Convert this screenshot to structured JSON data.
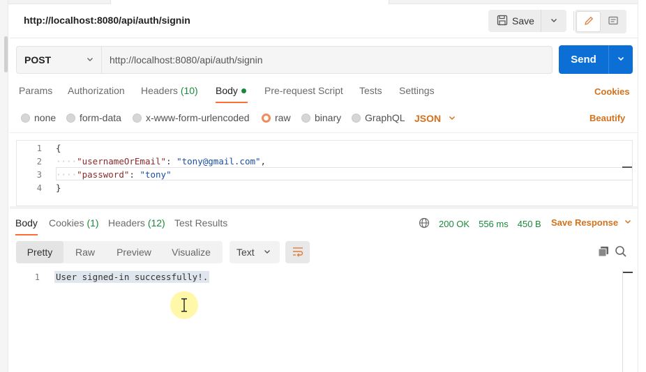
{
  "request_title": "http://localhost:8080/api/auth/signin",
  "toolbar": {
    "save_label": "Save",
    "save_icon": "floppy-disk-icon",
    "mode_icons": [
      "pencil-icon",
      "comment-icon"
    ]
  },
  "request": {
    "method": "POST",
    "url": "http://localhost:8080/api/auth/signin",
    "send_label": "Send"
  },
  "request_tabs": {
    "params": "Params",
    "authorization": "Authorization",
    "headers": "Headers",
    "headers_count": "(10)",
    "body": "Body",
    "prerequest": "Pre-request Script",
    "tests": "Tests",
    "settings": "Settings",
    "active": "Body",
    "cookies_link": "Cookies"
  },
  "body_types": {
    "none": "none",
    "form_data": "form-data",
    "urlencoded": "x-www-form-urlencoded",
    "raw": "raw",
    "binary": "binary",
    "graphql": "GraphQL",
    "selected": "raw",
    "language": "JSON",
    "beautify": "Beautify"
  },
  "editor": {
    "line_numbers": [
      "1",
      "2",
      "3",
      "4"
    ],
    "open_brace": "{",
    "close_brace": "}",
    "key1": "\"usernameOrEmail\"",
    "val1": "\"tony@gmail.com\"",
    "key2": "\"password\"",
    "val2": "\"tony\"",
    "indent_dots": "····"
  },
  "response_tabs": {
    "body": "Body",
    "cookies": "Cookies",
    "cookies_count": "(1)",
    "headers": "Headers",
    "headers_count": "(12)",
    "test_results": "Test Results",
    "active": "Body"
  },
  "response_status": {
    "status": "200 OK",
    "time": "556 ms",
    "size": "450 B",
    "save_response": "Save Response"
  },
  "response_view": {
    "pretty": "Pretty",
    "raw": "Raw",
    "preview": "Preview",
    "visualize": "Visualize",
    "active": "Pretty",
    "format": "Text"
  },
  "response_body": {
    "line_number": "1",
    "text": "User signed-in successfully!."
  },
  "colors": {
    "accent_orange": "#ff6c37",
    "link_orange": "#d4711c",
    "send_blue": "#0b6fd6",
    "status_green": "#1a8a3a"
  }
}
